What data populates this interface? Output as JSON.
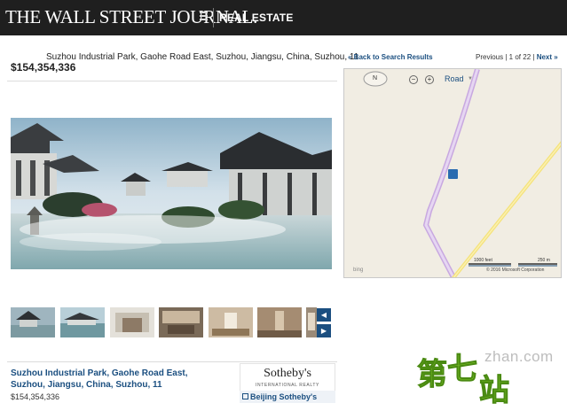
{
  "header": {
    "masthead": "THE WALL STREET JOURNAL.",
    "section": "REAL ESTATE"
  },
  "listing": {
    "address_top": "Suzhou Industrial Park, Gaohe Road East, Suzhou, Jiangsu, China, Suzhou, 11",
    "price": "$154,354,336",
    "address_bottom": "Suzhou Industrial Park, Gaohe Road East, Suzhou, Jiangsu, China, Suzhou, 11",
    "price_bottom": "$154,354,336"
  },
  "gallery": {
    "thumbnail_count": 7,
    "prev_icon": "triangle-left-icon",
    "next_icon": "triangle-right-icon"
  },
  "agency": {
    "name": "Sotheby's",
    "subtitle": "INTERNATIONAL REALTY",
    "link": "Beijing Sotheby's"
  },
  "navigation": {
    "back": "« Back to Search Results",
    "previous": "Previous",
    "sep1": "|",
    "position": "1 of 22",
    "sep2": "|",
    "next": "Next »"
  },
  "map": {
    "compass_label": "N",
    "zoom_out": "−",
    "zoom_in": "+",
    "map_type": "Road",
    "scale_feet": "1000 feet",
    "scale_meters": "250 m",
    "provider": "bing",
    "copyright": "© 2016 Microsoft Corporation"
  },
  "watermark": {
    "site": "zhan.com",
    "chars": [
      "第",
      "七",
      "站"
    ]
  },
  "colors": {
    "header_bg": "#1f1f1f",
    "link": "#1b4f80",
    "map_bg": "#f1ede3",
    "road_purple": "#c8a8e0",
    "road_yellow": "#f4e27a"
  }
}
